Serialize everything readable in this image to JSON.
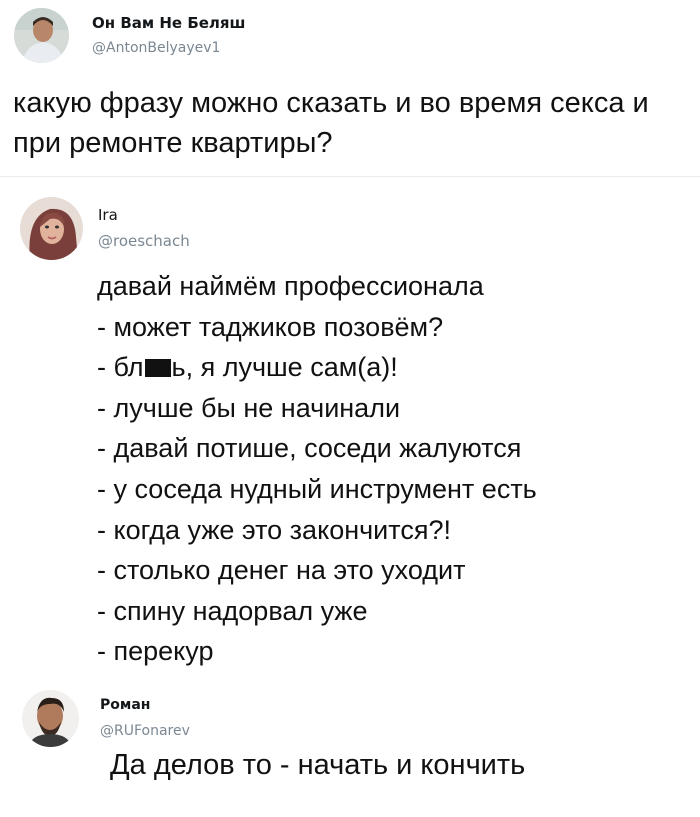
{
  "tweet": {
    "author_name": "Он Вам Не Беляш",
    "author_handle": "@AntonBelyayev1",
    "text": "какую фразу можно сказать и во время секса и при ремонте квартиры?"
  },
  "reply1": {
    "author_name": "Ira",
    "author_handle": "@roeschach",
    "lines": [
      "давай наймём профессионала",
      "- может таджиков позовём?",
      {
        "prefix": "- бл",
        "suffix": "ь, я лучше сам(а)!"
      },
      "- лучше бы не начинали",
      "- давай потише, соседи жалуются",
      "- у соседа нудный инструмент есть",
      "- когда уже это закончится?!",
      "- столько денег на это уходит",
      "- спину надорвал уже",
      "- перекур"
    ]
  },
  "reply2": {
    "author_name": "Роман",
    "author_handle": "@RUFonarev",
    "text": "Да делов то - начать и кончить"
  }
}
